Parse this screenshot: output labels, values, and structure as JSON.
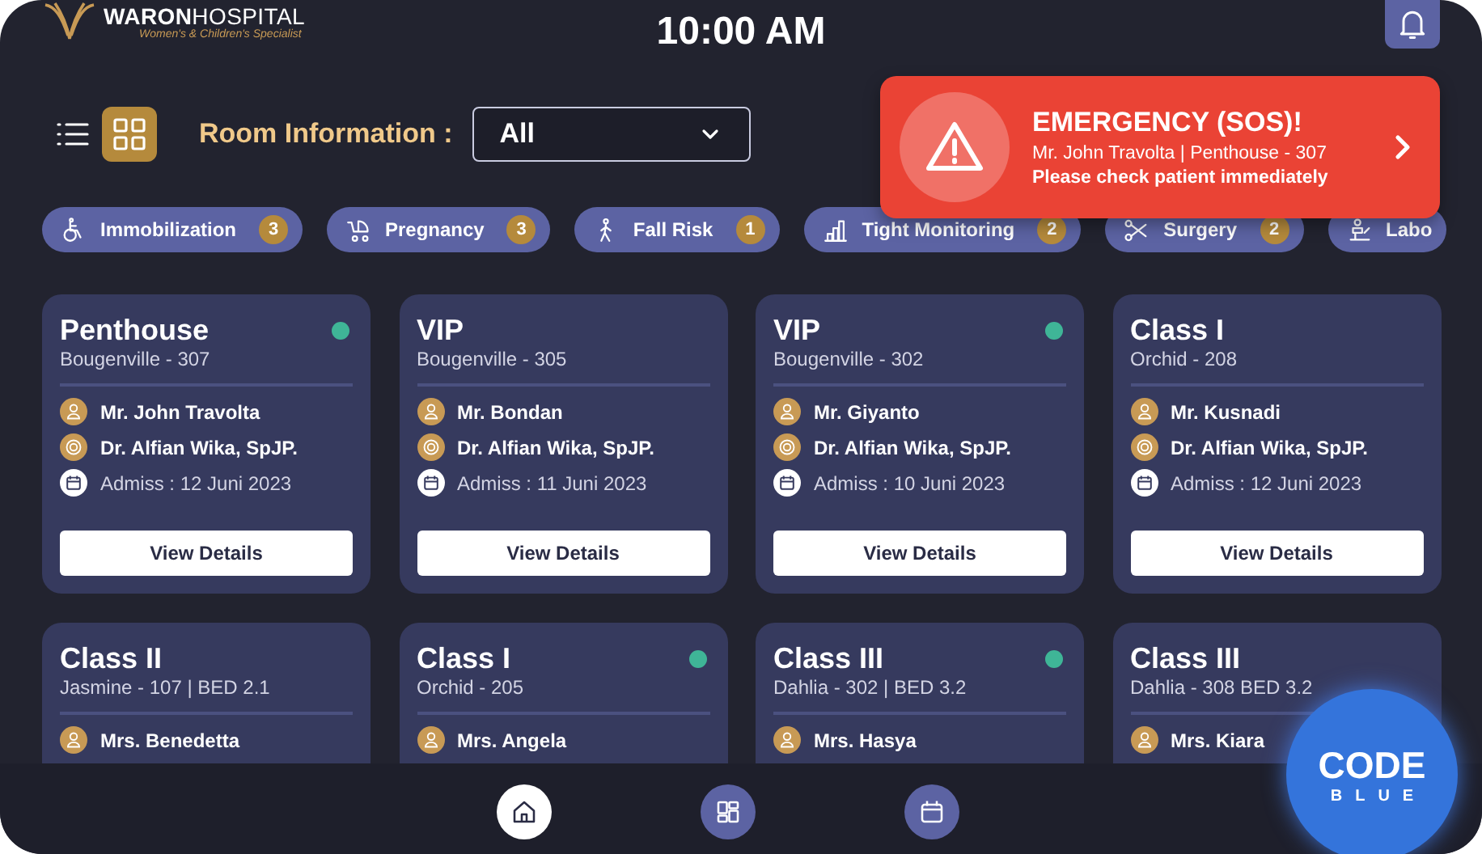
{
  "header": {
    "logo_name": "**WARON**HOSPITAL",
    "tagline": "Women's & Children's Specialist",
    "time": "10:00 AM"
  },
  "toolbar": {
    "views": [
      {
        "kind": "list",
        "selected": false
      },
      {
        "kind": "grid",
        "selected": true
      }
    ],
    "label": "Room Information :",
    "filter": {
      "value": "All"
    }
  },
  "emergency": {
    "title": "EMERGENCY (SOS)!",
    "detail": "Mr. John Travolta | Penthouse - 307",
    "message": "Please check patient immediately"
  },
  "categories": [
    {
      "kind": "wheelchair",
      "label": "Immobilization",
      "count": "3"
    },
    {
      "kind": "stroller",
      "label": "Pregnancy",
      "count": "3"
    },
    {
      "kind": "walker",
      "label": "Fall Risk",
      "count": "1"
    },
    {
      "kind": "chart",
      "label": "Tight Monitoring",
      "count": "2"
    },
    {
      "kind": "scissors",
      "label": "Surgery",
      "count": "2"
    },
    {
      "kind": "lab",
      "label": "Labo"
    }
  ],
  "rooms": [
    {
      "room": "Penthouse",
      "location": "Bougenville - 307",
      "indicator": true,
      "patient": "Mr. John Travolta",
      "doctor": "Dr. Alfian Wika, SpJP.",
      "admission": "Admiss : 12 Juni 2023",
      "action": "View Details"
    },
    {
      "room": "VIP",
      "location": "Bougenville - 305",
      "indicator": false,
      "patient": "Mr. Bondan",
      "doctor": "Dr. Alfian Wika, SpJP.",
      "admission": "Admiss : 11 Juni 2023",
      "action": "View Details"
    },
    {
      "room": "VIP",
      "location": "Bougenville - 302",
      "indicator": true,
      "patient": "Mr. Giyanto",
      "doctor": "Dr. Alfian Wika, SpJP.",
      "admission": "Admiss : 10 Juni 2023",
      "action": "View Details"
    },
    {
      "room": "Class I",
      "location": "Orchid - 208",
      "indicator": false,
      "patient": "Mr. Kusnadi",
      "doctor": "Dr. Alfian Wika, SpJP.",
      "admission": "Admiss : 12 Juni 2023",
      "action": "View Details"
    },
    {
      "room": "Class II",
      "location": "Jasmine - 107 | BED 2.1",
      "indicator": false,
      "patient": "Mrs. Benedetta"
    },
    {
      "room": "Class I",
      "location": "Orchid - 205",
      "indicator": true,
      "patient": "Mrs. Angela"
    },
    {
      "room": "Class III",
      "location": "Dahlia - 302 | BED 3.2",
      "indicator": true,
      "patient": "Mrs. Hasya"
    },
    {
      "room": "Class III",
      "location": "Dahlia - 308 BED 3.2",
      "indicator": false,
      "patient": "Mrs. Kiara"
    }
  ],
  "nav": [
    {
      "kind": "home",
      "selected": true
    },
    {
      "kind": "rooms",
      "selected": false
    },
    {
      "kind": "schedule",
      "selected": false
    }
  ],
  "code_blue": {
    "label": "CODE",
    "sublabel": "BLUE"
  }
}
